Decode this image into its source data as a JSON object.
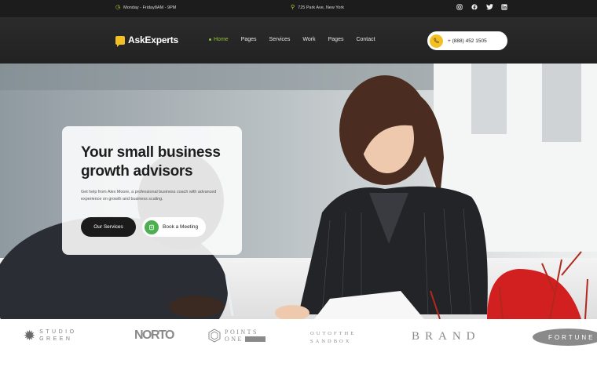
{
  "topbar": {
    "hours": "Monday - Friday8AM - 9PM",
    "address": "725 Park Ave, New York",
    "social": [
      "instagram-icon",
      "facebook-icon",
      "twitter-icon",
      "linkedin-icon"
    ]
  },
  "header": {
    "logo": "AskExperts",
    "nav": [
      {
        "label": "Home",
        "active": true
      },
      {
        "label": "Pages",
        "active": false
      },
      {
        "label": "Services",
        "active": false
      },
      {
        "label": "Work",
        "active": false
      },
      {
        "label": "Pages",
        "active": false
      },
      {
        "label": "Contact",
        "active": false
      }
    ],
    "phone": "+ (888) 452 1505"
  },
  "hero": {
    "title": "Your small business growth advisors",
    "text": "Get help from Alex Moore, a professional business coach with advanced experience on growth and business scaling.",
    "primary_button": "Our Services",
    "secondary_button": "Book a Meeting"
  },
  "brands": {
    "studio_green_1": "STUDIO",
    "studio_green_2": "GREEN",
    "norto": "NORTO",
    "points_one_1": "POINTS",
    "points_one_2": "ONE",
    "out_of_the_box_1": "OUTOFTHE",
    "out_of_the_box_2": "SANDBOX",
    "brand": "BRAND",
    "fortune": "FORTUNE"
  },
  "colors": {
    "accent_green": "#8fc33a",
    "phone_yellow": "#f2c024",
    "dark": "#1b1b1b"
  }
}
